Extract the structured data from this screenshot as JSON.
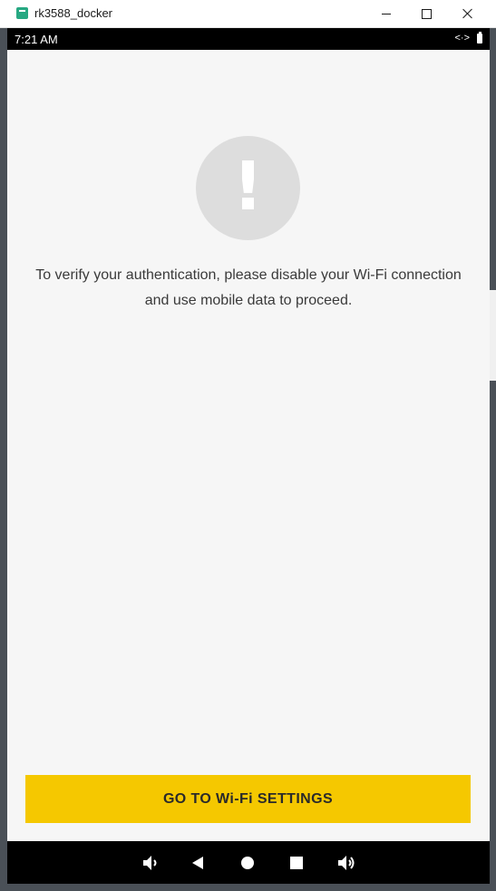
{
  "window": {
    "title": "rk3588_docker",
    "controls": {
      "minimize": "minimize-icon",
      "maximize": "maximize-icon",
      "close": "close-icon"
    }
  },
  "status_bar": {
    "time": "7:21 AM",
    "icons": [
      "code-icon",
      "battery-icon"
    ]
  },
  "screen": {
    "alert_icon": "exclamation-icon",
    "alert_glyph": "!",
    "message": "To verify your authentication, please disable your Wi-Fi connection and use mobile data to proceed.",
    "primary_button": "GO TO Wi-Fi SETTINGS"
  },
  "nav_bar": {
    "buttons": [
      "volume-down-icon",
      "back-icon",
      "home-icon",
      "recents-icon",
      "volume-up-icon"
    ]
  },
  "colors": {
    "accent": "#f5c800",
    "screen_bg": "#f6f6f6",
    "alert_circle": "#dddddd",
    "bar_bg": "#000000"
  }
}
